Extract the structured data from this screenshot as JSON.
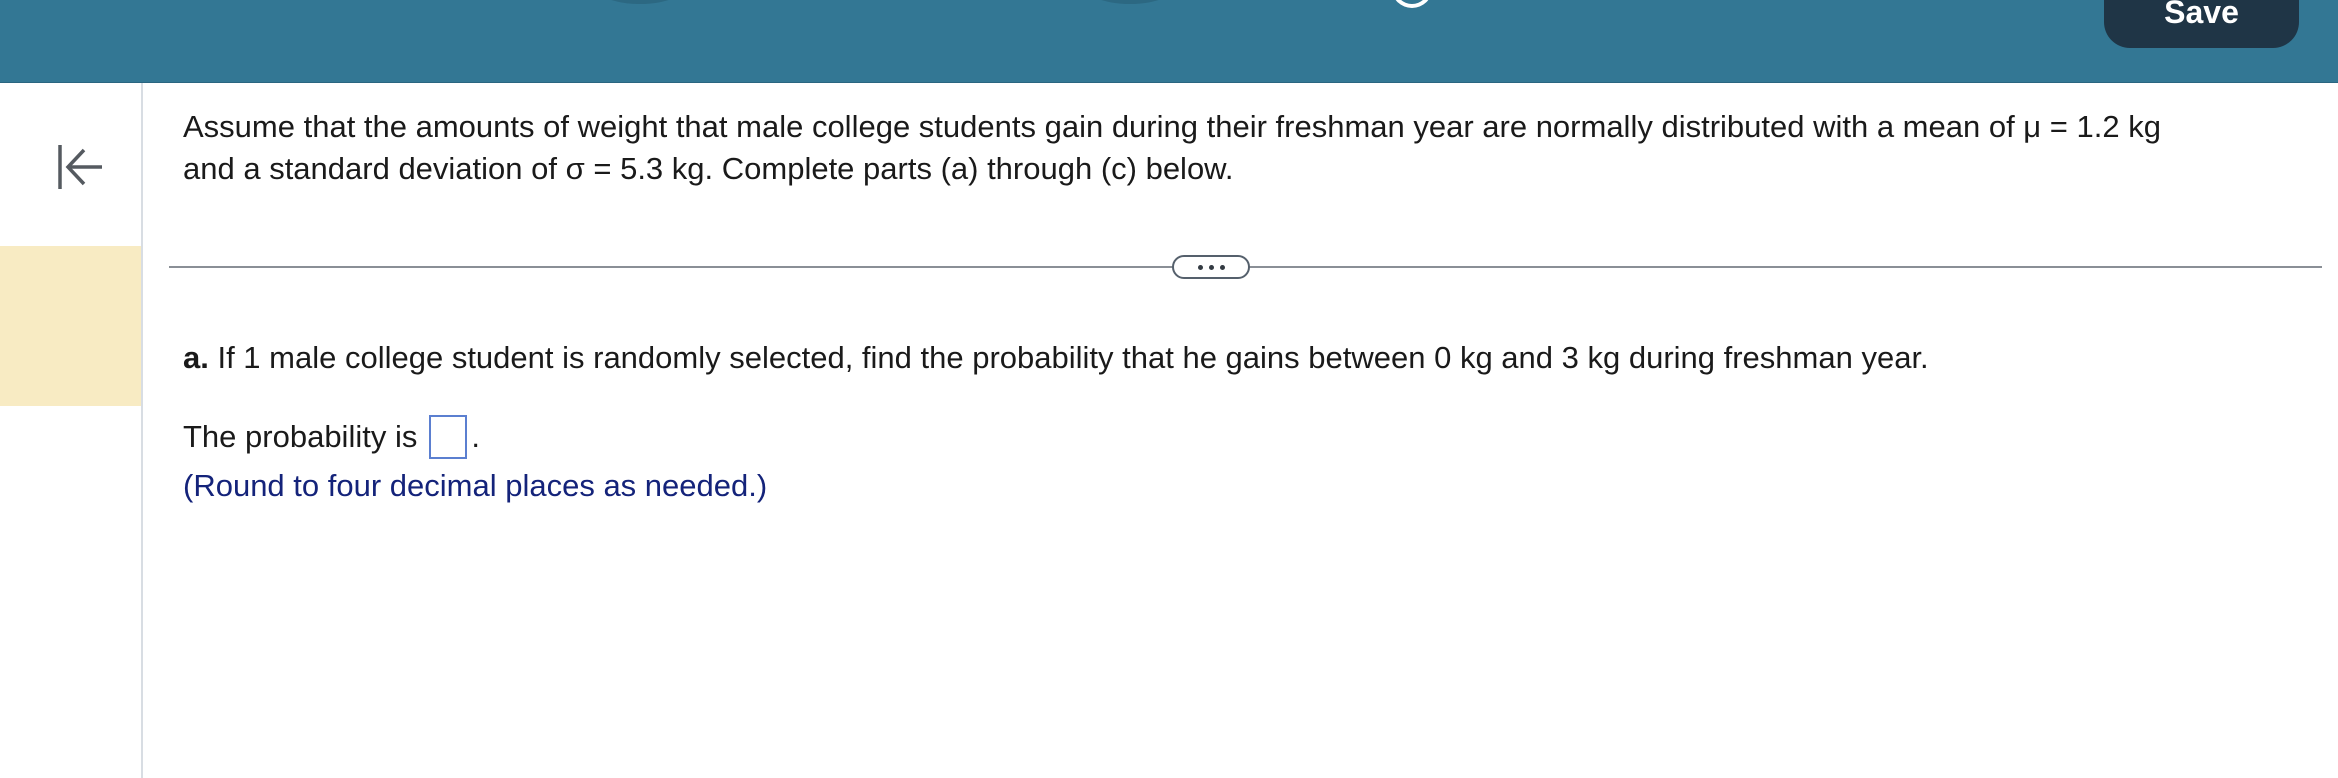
{
  "header": {
    "save_label": "Save",
    "bar_color": "#337794"
  },
  "sidebar": {
    "collapse_icon": "collapse-left-icon",
    "highlight_color": "#f8ebc3"
  },
  "problem": {
    "intro_line1": "Assume that the amounts of weight that male college students gain during their freshman year are normally distributed with a mean of μ = 1.2 kg",
    "intro_line2": "and a standard deviation of σ = 5.3 kg. Complete parts (a) through (c) below.",
    "part_label": "a.",
    "part_text": " If 1 male college student is randomly selected, find the probability that he gains between 0 kg and 3 kg during freshman year.",
    "answer_prefix": "The probability is",
    "answer_suffix": ".",
    "answer_value": "",
    "hint": "(Round to four decimal places as needed.)"
  }
}
